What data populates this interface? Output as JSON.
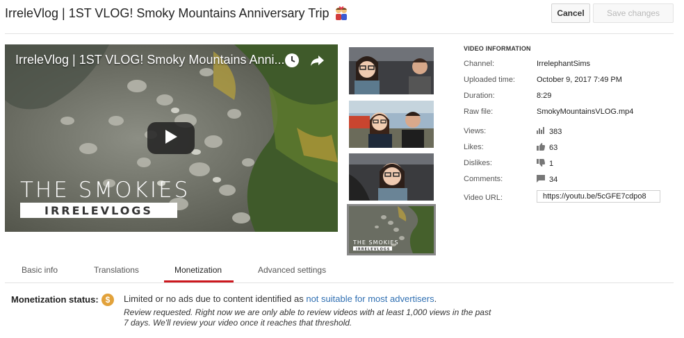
{
  "header": {
    "title": "IrreleVlog | 1ST VLOG! Smoky Mountains Anniversary Trip",
    "title_emoji": "couple-emoji",
    "cancel_label": "Cancel",
    "save_label": "Save changes"
  },
  "player": {
    "title": "IrreleVlog | 1ST VLOG! Smoky Mountains Anni...",
    "overlay_line1": "THE SMOKIES",
    "overlay_line2": "IRRELEVLOGS",
    "icons": [
      "clock-icon",
      "share-icon",
      "play-icon"
    ]
  },
  "thumbnails": [
    {
      "name": "thumbnail-1",
      "selected": false
    },
    {
      "name": "thumbnail-2",
      "selected": false
    },
    {
      "name": "thumbnail-3",
      "selected": false
    },
    {
      "name": "thumbnail-4",
      "selected": true
    }
  ],
  "video_info": {
    "heading": "VIDEO INFORMATION",
    "channel_label": "Channel:",
    "channel": "IrrelephantSims",
    "uploaded_label": "Uploaded time:",
    "uploaded": "October 9, 2017 7:49 PM",
    "duration_label": "Duration:",
    "duration": "8:29",
    "raw_file_label": "Raw file:",
    "raw_file": "SmokyMountainsVLOG.mp4",
    "views_label": "Views:",
    "views": "383",
    "likes_label": "Likes:",
    "likes": "63",
    "dislikes_label": "Dislikes:",
    "dislikes": "1",
    "comments_label": "Comments:",
    "comments": "34",
    "url_label": "Video URL:",
    "url": "https://youtu.be/5cGFE7cdpo8"
  },
  "tabs": [
    {
      "label": "Basic info",
      "active": false
    },
    {
      "label": "Translations",
      "active": false
    },
    {
      "label": "Monetization",
      "active": true
    },
    {
      "label": "Advanced settings",
      "active": false
    }
  ],
  "monetization": {
    "label": "Monetization status:",
    "coin_symbol": "$",
    "status_prefix": "Limited or no ads due to content identified as ",
    "status_link": "not suitable for most advertisers",
    "status_suffix": ".",
    "note": "Review requested.   Right now we are only able to review videos with at least 1,000 views in the past 7 days.   We'll review your video once it reaches that threshold."
  },
  "colors": {
    "accent_red": "#cc181e",
    "link_blue": "#2f6fb2",
    "coin": "#e2a23b"
  }
}
